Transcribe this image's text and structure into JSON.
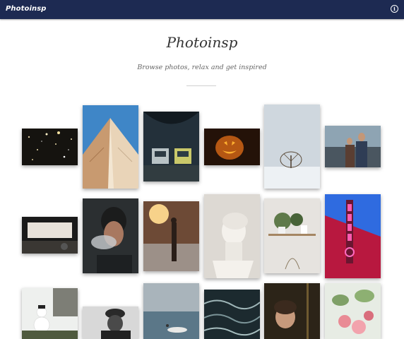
{
  "navbar": {
    "brand": "Photoinsp",
    "info_icon": "info-icon"
  },
  "hero": {
    "title": "Photoinsp",
    "subtitle": "Browse photos, relax and get inspired"
  },
  "gallery": {
    "photos": [
      "snowy-night-lights",
      "white-building-corner",
      "subway-trains",
      "carved-pumpkin",
      "lone-tree-snow",
      "couple-street",
      "car-windshield",
      "man-smoke",
      "person-sunset",
      "statue-bust",
      "shelf-plants",
      "neon-sign",
      "snowman",
      "man-hat",
      "beach-boat",
      "ocean-waves",
      "woman-portrait",
      "pink-flowers"
    ]
  }
}
